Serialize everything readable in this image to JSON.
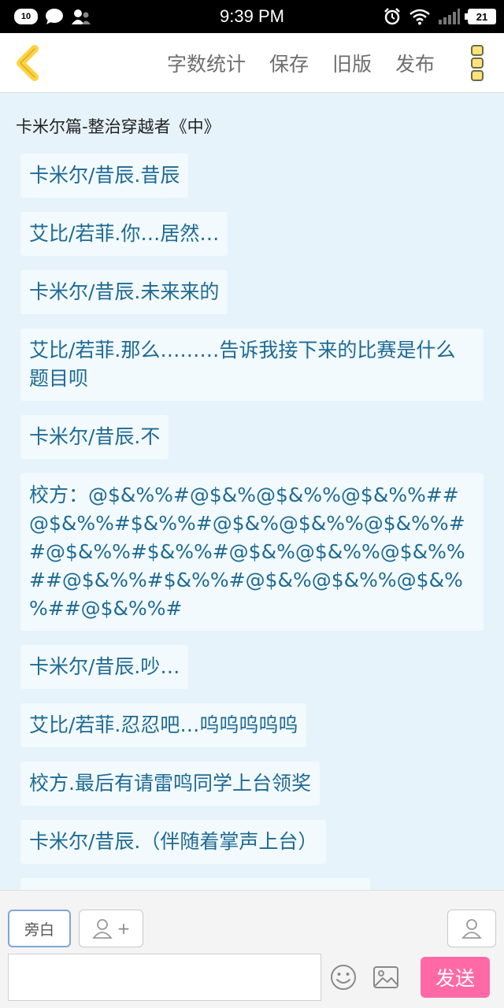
{
  "status_bar": {
    "notification_count": "10",
    "time": "9:39 PM",
    "battery": "21"
  },
  "toolbar": {
    "word_count": "字数统计",
    "save": "保存",
    "old_version": "旧版",
    "publish": "发布"
  },
  "doc": {
    "title": "卡米尔篇-整治穿越者《中》",
    "lines": [
      "卡米尔/昔辰.昔辰",
      "艾比/若菲.你…居然…",
      "卡米尔/昔辰.未来来的",
      "艾比/若菲.那么………告诉我接下来的比赛是什么题目呗",
      "卡米尔/昔辰.不",
      "校方：@$&%%#@$&%@$&%%@$&%%##@$&%%#$&%%#@$&%@$&%%@$&%%##@$&%%#$&%%#@$&%@$&%%@$&%%##@$&%%#$&%%#@$&%@$&%%@$&%%##@$&%%#",
      "卡米尔/昔辰.吵…",
      "艾比/若菲.忍忍吧…呜呜呜呜呜",
      "校方.最后有请雷鸣同学上台领奖",
      "卡米尔/昔辰.（伴随着掌声上台）"
    ]
  },
  "bottom": {
    "narration": "旁白",
    "plus": "+",
    "send": "发送",
    "input_placeholder": ""
  },
  "colors": {
    "accent": "#ffd23f",
    "send": "#ff6aa6",
    "line_text": "#1e6a93",
    "background": "#e6f3fa"
  },
  "icons": [
    "back-chevron-icon",
    "more-dots-icon",
    "person-icon",
    "smiley-icon",
    "image-icon",
    "alarm-icon",
    "wifi-icon",
    "signal-icon",
    "chat-bubble-icon",
    "contacts-icon"
  ]
}
